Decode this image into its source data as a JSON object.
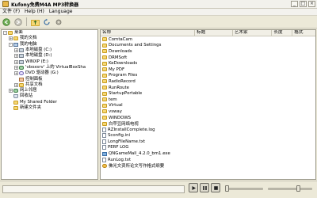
{
  "app": {
    "title": "Kufony免费M4A MP3转换器",
    "window_buttons": [
      "_",
      "□",
      "×"
    ]
  },
  "menu": [
    "文件 (F)",
    "Help (H)",
    "Language"
  ],
  "toolbar": {
    "icons": [
      "back-icon",
      "forward-icon",
      "up-folder-icon",
      "refresh-icon",
      "settings-icon"
    ]
  },
  "tree": {
    "items": [
      {
        "label": "桌面",
        "icon": "folder",
        "expander": "-",
        "indent": 0
      },
      {
        "label": "我的文档",
        "icon": "folder",
        "expander": "+",
        "indent": 1
      },
      {
        "label": "我的电脑",
        "icon": "pc",
        "expander": "-",
        "indent": 1
      },
      {
        "label": "本地磁盘 (C:)",
        "icon": "drive",
        "expander": "+",
        "indent": 2
      },
      {
        "label": "本地磁盘 (D:)",
        "icon": "drive",
        "expander": "+",
        "indent": 2
      },
      {
        "label": "WINXP (E:)",
        "icon": "drive",
        "expander": "+",
        "indent": 2
      },
      {
        "label": "'vboxsrv' 上的 VirtualBoxSha",
        "icon": "net",
        "expander": "+",
        "indent": 2
      },
      {
        "label": "DVD 驱动器 (G:)",
        "icon": "dvd",
        "expander": "+",
        "indent": 2
      },
      {
        "label": "控制面板",
        "icon": "cp",
        "expander": "",
        "indent": 2
      },
      {
        "label": "共享文档",
        "icon": "folder",
        "expander": "+",
        "indent": 2
      },
      {
        "label": "网上邻居",
        "icon": "net",
        "expander": "+",
        "indent": 1
      },
      {
        "label": "回收站",
        "icon": "bin",
        "expander": "",
        "indent": 1
      },
      {
        "label": "My Shared Folder",
        "icon": "folder",
        "expander": "",
        "indent": 1
      },
      {
        "label": "新建文件夹",
        "icon": "folder",
        "expander": "",
        "indent": 1
      }
    ]
  },
  "list": {
    "columns": [
      "名称",
      "标题",
      "艺术家",
      "长度",
      "格式"
    ],
    "rows": [
      {
        "name": "ComtaCam",
        "type": "folder"
      },
      {
        "name": "Documents and Settings",
        "type": "folder"
      },
      {
        "name": "Downloads",
        "type": "folder"
      },
      {
        "name": "DRMSoft",
        "type": "folder"
      },
      {
        "name": "KeDownloads",
        "type": "folder"
      },
      {
        "name": "My PDF",
        "type": "folder"
      },
      {
        "name": "Program Files",
        "type": "folder"
      },
      {
        "name": "RadioRecord",
        "type": "folder"
      },
      {
        "name": "RunRoute",
        "type": "folder"
      },
      {
        "name": "StartupPortable",
        "type": "folder"
      },
      {
        "name": "tem",
        "type": "folder"
      },
      {
        "name": "Virtual",
        "type": "folder"
      },
      {
        "name": "vsway",
        "type": "folder"
      },
      {
        "name": "WINDOWS",
        "type": "folder"
      },
      {
        "name": "白苹豆网络电视",
        "type": "folder"
      },
      {
        "name": "RZInstallComplete.log",
        "type": "doc"
      },
      {
        "name": "Sconfig.ini",
        "type": "doc"
      },
      {
        "name": "LongFileName.txt",
        "type": "doc"
      },
      {
        "name": "PERF LOG",
        "type": "doc"
      },
      {
        "name": "QNGameMall_4.2.0_bm1.exe",
        "type": "exe"
      },
      {
        "name": "RunLog.txt",
        "type": "doc"
      },
      {
        "name": "佛光文资所论文写作格式纲要",
        "type": "mp3"
      }
    ]
  },
  "status": {
    "text": ""
  },
  "player": {
    "controls": [
      "play-icon",
      "pause-icon",
      "stop-icon"
    ],
    "track_position": 0.0,
    "volume": 0.7
  }
}
